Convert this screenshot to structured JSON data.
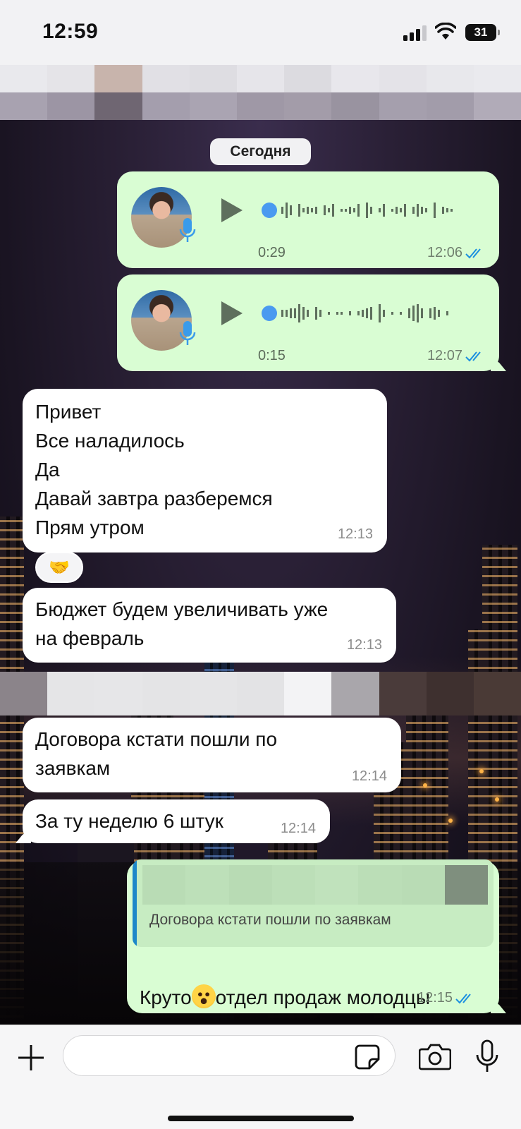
{
  "status_bar": {
    "time": "12:59",
    "battery": "31"
  },
  "date_separator": "Сегодня",
  "messages": [
    {
      "type": "voice",
      "direction": "out",
      "duration": "0:29",
      "time": "12:06",
      "read": true
    },
    {
      "type": "voice",
      "direction": "out",
      "duration": "0:15",
      "time": "12:07",
      "read": true
    },
    {
      "type": "text",
      "direction": "in",
      "text": "Привет\nВсе наладилось\nДа\nДавай завтра разберемся\nПрям утром",
      "time": "12:13"
    },
    {
      "type": "text",
      "direction": "in",
      "text": "Бюджет будем увеличивать уже\nна февраль",
      "time": "12:13"
    },
    {
      "type": "text",
      "direction": "in",
      "text": "Договора кстати пошли по\nзаявкам",
      "time": "12:14"
    },
    {
      "type": "text",
      "direction": "in",
      "text": "За ту неделю 6 штук",
      "time": "12:14"
    },
    {
      "type": "reply",
      "direction": "out",
      "quote_text": "Договора кстати пошли по заявкам",
      "text_before": "Круто",
      "text_after": "отдел продаж молодцы",
      "time": "12:15",
      "read": true
    }
  ],
  "reaction": "🤝",
  "input": {
    "placeholder": ""
  },
  "icons": {
    "play": "play-icon",
    "mic_badge": "mic-icon",
    "ticks": "double-check-icon",
    "plus": "plus-icon",
    "sticker": "sticker-icon",
    "camera": "camera-icon",
    "mic": "microphone-icon"
  },
  "colors": {
    "outgoing_bubble": "#d9fdd3",
    "incoming_bubble": "#ffffff",
    "read_ticks": "#1a8fe0",
    "waveform": "#5e6f5d",
    "wave_dot": "#4a9af0"
  }
}
